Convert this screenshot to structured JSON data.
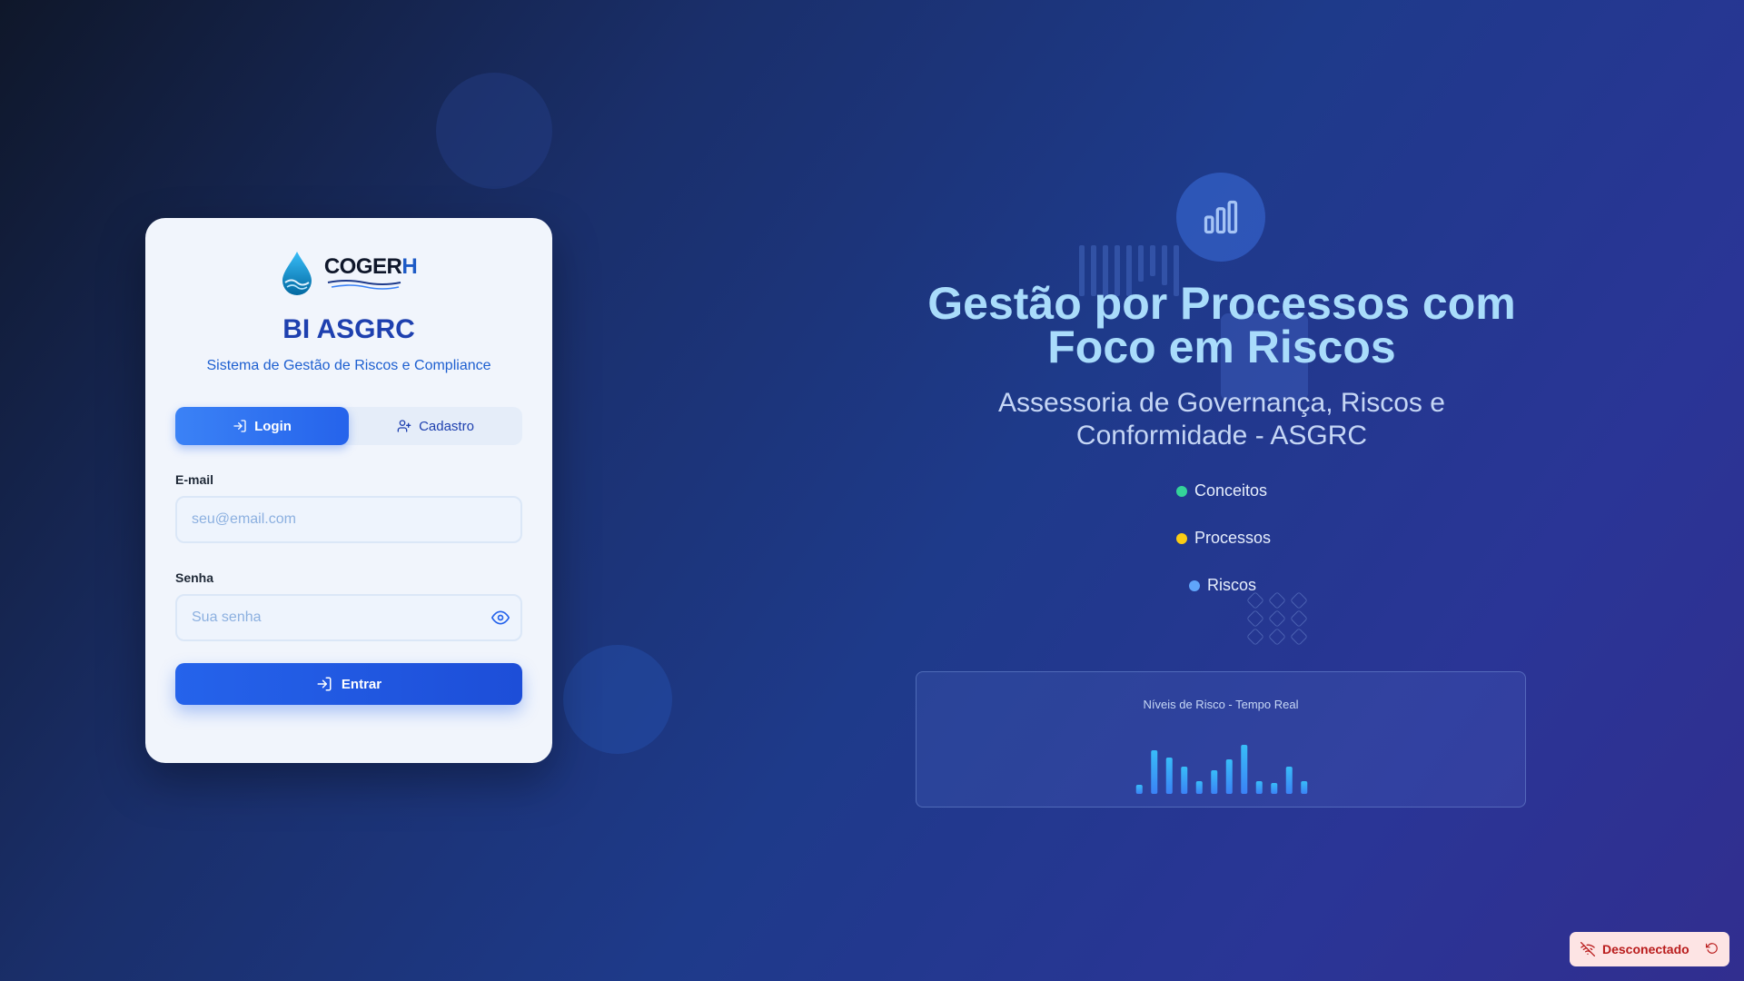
{
  "brand": {
    "logo_prefix": "COGER",
    "logo_suffix": "H",
    "colors": {
      "primary": "#2563eb",
      "accent": "#1e40af"
    }
  },
  "card": {
    "title": "BI ASGRC",
    "subtitle": "Sistema de Gestão de Riscos e Compliance",
    "tabs": [
      {
        "label": "Login",
        "icon": "login-icon",
        "active": true
      },
      {
        "label": "Cadastro",
        "icon": "user-plus-icon",
        "active": false
      }
    ],
    "email": {
      "label": "E-mail",
      "placeholder": "seu@email.com",
      "value": ""
    },
    "password": {
      "label": "Senha",
      "placeholder": "Sua senha",
      "value": ""
    },
    "submit_label": "Entrar"
  },
  "hero": {
    "title": "Gestão por Processos com Foco em Riscos",
    "subtitle": "Assessoria de Governança, Riscos e Conformidade - ASGRC",
    "legend": [
      {
        "label": "Conceitos",
        "color": "#34d399"
      },
      {
        "label": "Processos",
        "color": "#facc15"
      },
      {
        "label": "Riscos",
        "color": "#60a5fa"
      }
    ],
    "chart": {
      "title": "Níveis de Risco - Tempo Real",
      "values": [
        10,
        48,
        40,
        30,
        14,
        26,
        38,
        54,
        14,
        12,
        30,
        14
      ]
    }
  },
  "status": {
    "label": "Desconectado",
    "color": "#b91c1c"
  }
}
